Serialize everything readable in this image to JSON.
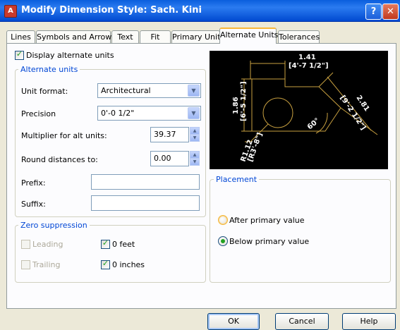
{
  "window": {
    "title": "Modify Dimension Style: Sach. Kini",
    "help_glyph": "?",
    "close_glyph": "✕",
    "icon_glyph": "A"
  },
  "tabs": [
    {
      "label": "Lines"
    },
    {
      "label": "Symbols and Arrows"
    },
    {
      "label": "Text"
    },
    {
      "label": "Fit"
    },
    {
      "label": "Primary Units"
    },
    {
      "label": "Alternate Units",
      "active": true
    },
    {
      "label": "Tolerances"
    }
  ],
  "display_alt_units": {
    "label": "Display alternate units",
    "checked": true
  },
  "alternate_units": {
    "legend": "Alternate units",
    "unit_format": {
      "label": "Unit format:",
      "value": "Architectural"
    },
    "precision": {
      "label": "Precision",
      "value": "0'-0 1/2\""
    },
    "multiplier": {
      "label": "Multiplier for alt units:",
      "value": "39.37"
    },
    "round": {
      "label": "Round distances  to:",
      "value": "0.00"
    },
    "prefix": {
      "label": "Prefix:",
      "value": ""
    },
    "suffix": {
      "label": "Suffix:",
      "value": ""
    }
  },
  "zero_suppression": {
    "legend": "Zero suppression",
    "leading": {
      "label": "Leading",
      "checked": false,
      "enabled": false
    },
    "trailing": {
      "label": "Trailing",
      "checked": false,
      "enabled": false
    },
    "feet": {
      "label": "0 feet",
      "checked": true
    },
    "inches": {
      "label": "0 inches",
      "checked": true
    }
  },
  "placement": {
    "legend": "Placement",
    "after": {
      "label": "After primary value",
      "selected": false
    },
    "below": {
      "label": "Below primary value",
      "selected": true
    }
  },
  "preview": {
    "top_dim": "1.41",
    "top_alt": "[4'-7 1/2\"]",
    "left_dim": "1.86",
    "left_alt": "[6'-5 1/2\"]",
    "right_dim": "2.81",
    "right_alt": "[9'-2 1/2\"]",
    "radius_dim": "R1.12",
    "radius_alt": "[R3'-8\"]",
    "angle": "60°",
    "line_color": "#C8A040",
    "text_color": "#FFFFFF"
  },
  "buttons": {
    "ok": "OK",
    "cancel": "Cancel",
    "help": "Help"
  }
}
